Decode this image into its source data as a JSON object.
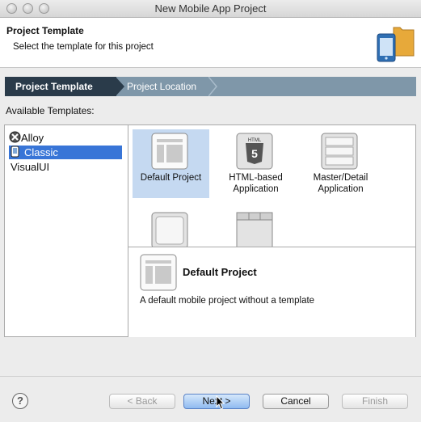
{
  "window": {
    "title": "New Mobile App Project"
  },
  "header": {
    "title": "Project Template",
    "subtitle": "Select the template for this project",
    "banner_icon": "mobile-project-banner-icon"
  },
  "breadcrumb": {
    "steps": [
      {
        "label": "Project Template",
        "active": true
      },
      {
        "label": "Project Location",
        "active": false
      }
    ]
  },
  "templates_label": "Available Templates:",
  "categories": [
    {
      "label": "Alloy",
      "icon": "alloy-icon"
    },
    {
      "label": "Classic",
      "icon": "phone-icon",
      "selected": true
    },
    {
      "label": "VisualUI"
    }
  ],
  "templates": [
    {
      "label": "Default Project",
      "icon": "default-project-icon",
      "selected": true
    },
    {
      "label": "HTML-based Application",
      "icon": "html5-icon"
    },
    {
      "label": "Master/Detail Application",
      "icon": "master-detail-icon"
    },
    {
      "label": "",
      "icon": "single-window-icon"
    },
    {
      "label": "",
      "icon": "tabbed-icon"
    }
  ],
  "detail": {
    "title": "Default Project",
    "description": "A default mobile project without a template",
    "icon": "default-project-icon"
  },
  "buttons": {
    "back": "< Back",
    "next": "Next >",
    "cancel": "Cancel",
    "finish": "Finish",
    "help": "?"
  }
}
